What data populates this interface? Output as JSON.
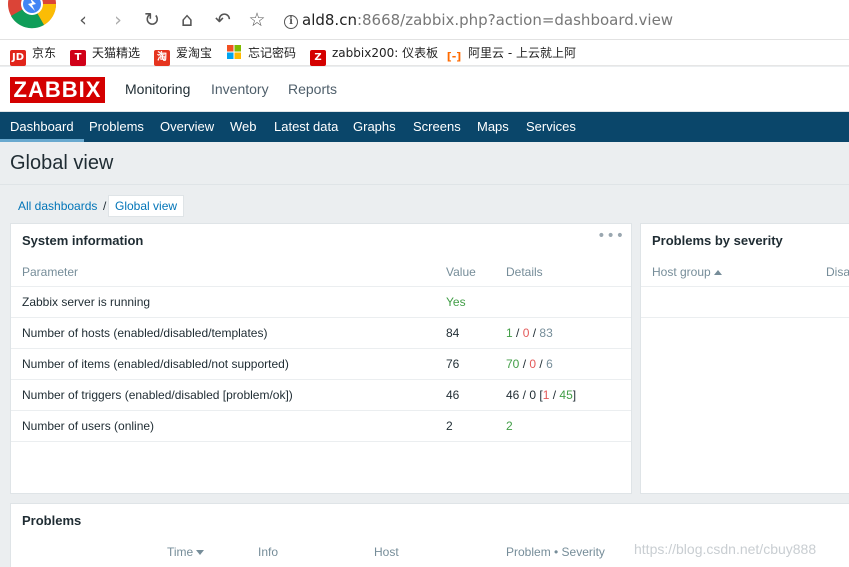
{
  "browser": {
    "url_host": "ald8.cn",
    "url_rest": ":8668/zabbix.php?action=dashboard.view",
    "bookmarks": [
      {
        "label": "京东",
        "icon": "JD",
        "color": "#e1251b"
      },
      {
        "label": "天猫精选",
        "icon": "T",
        "color": "#d00018"
      },
      {
        "label": "爱淘宝",
        "icon": "淘",
        "color": "#e5341f"
      },
      {
        "label": "忘记密码",
        "icon": "",
        "color": "#00a4ef"
      },
      {
        "label": "zabbix200: 仪表板",
        "icon": "Z",
        "color": "#d40000"
      },
      {
        "label": "阿里云 - 上云就上阿",
        "icon": "[-]",
        "color": "#ff6a00"
      }
    ]
  },
  "header": {
    "logo": "ZABBIX",
    "menu": [
      "Monitoring",
      "Inventory",
      "Reports"
    ]
  },
  "subnav": {
    "items": [
      "Dashboard",
      "Problems",
      "Overview",
      "Web",
      "Latest data",
      "Graphs",
      "Screens",
      "Maps",
      "Services"
    ],
    "selected": "Dashboard"
  },
  "page": {
    "title": "Global view",
    "breadcrumb_root": "All dashboards",
    "breadcrumb_sep": "/",
    "breadcrumb_current": "Global view"
  },
  "system_info": {
    "title": "System information",
    "menu": "•••",
    "headers": {
      "parameter": "Parameter",
      "value": "Value",
      "details": "Details"
    },
    "rows": [
      {
        "parameter": "Zabbix server is running",
        "value": "Yes"
      },
      {
        "parameter": "Number of hosts (enabled/disabled/templates)",
        "value": "84",
        "d1": "1",
        "d2": "0",
        "d3": "83"
      },
      {
        "parameter": "Number of items (enabled/disabled/not supported)",
        "value": "76",
        "d1": "70",
        "d2": "0",
        "d3": "6"
      },
      {
        "parameter": "Number of triggers (enabled/disabled [problem/ok])",
        "value": "46",
        "d_prefix": "46 / 0 [",
        "d1": "1",
        "d2": "45",
        "d_suffix": "]"
      },
      {
        "parameter": "Number of users (online)",
        "value": "2",
        "d1": "2"
      }
    ]
  },
  "problems_by_severity": {
    "title": "Problems by severity",
    "headers": {
      "host_group": "Host group",
      "disaster": "Disa"
    }
  },
  "problems": {
    "title": "Problems",
    "headers": {
      "time": "Time",
      "info": "Info",
      "host": "Host",
      "problem": "Problem • Severity"
    }
  },
  "watermark": "https://blog.csdn.net/cbuy888"
}
